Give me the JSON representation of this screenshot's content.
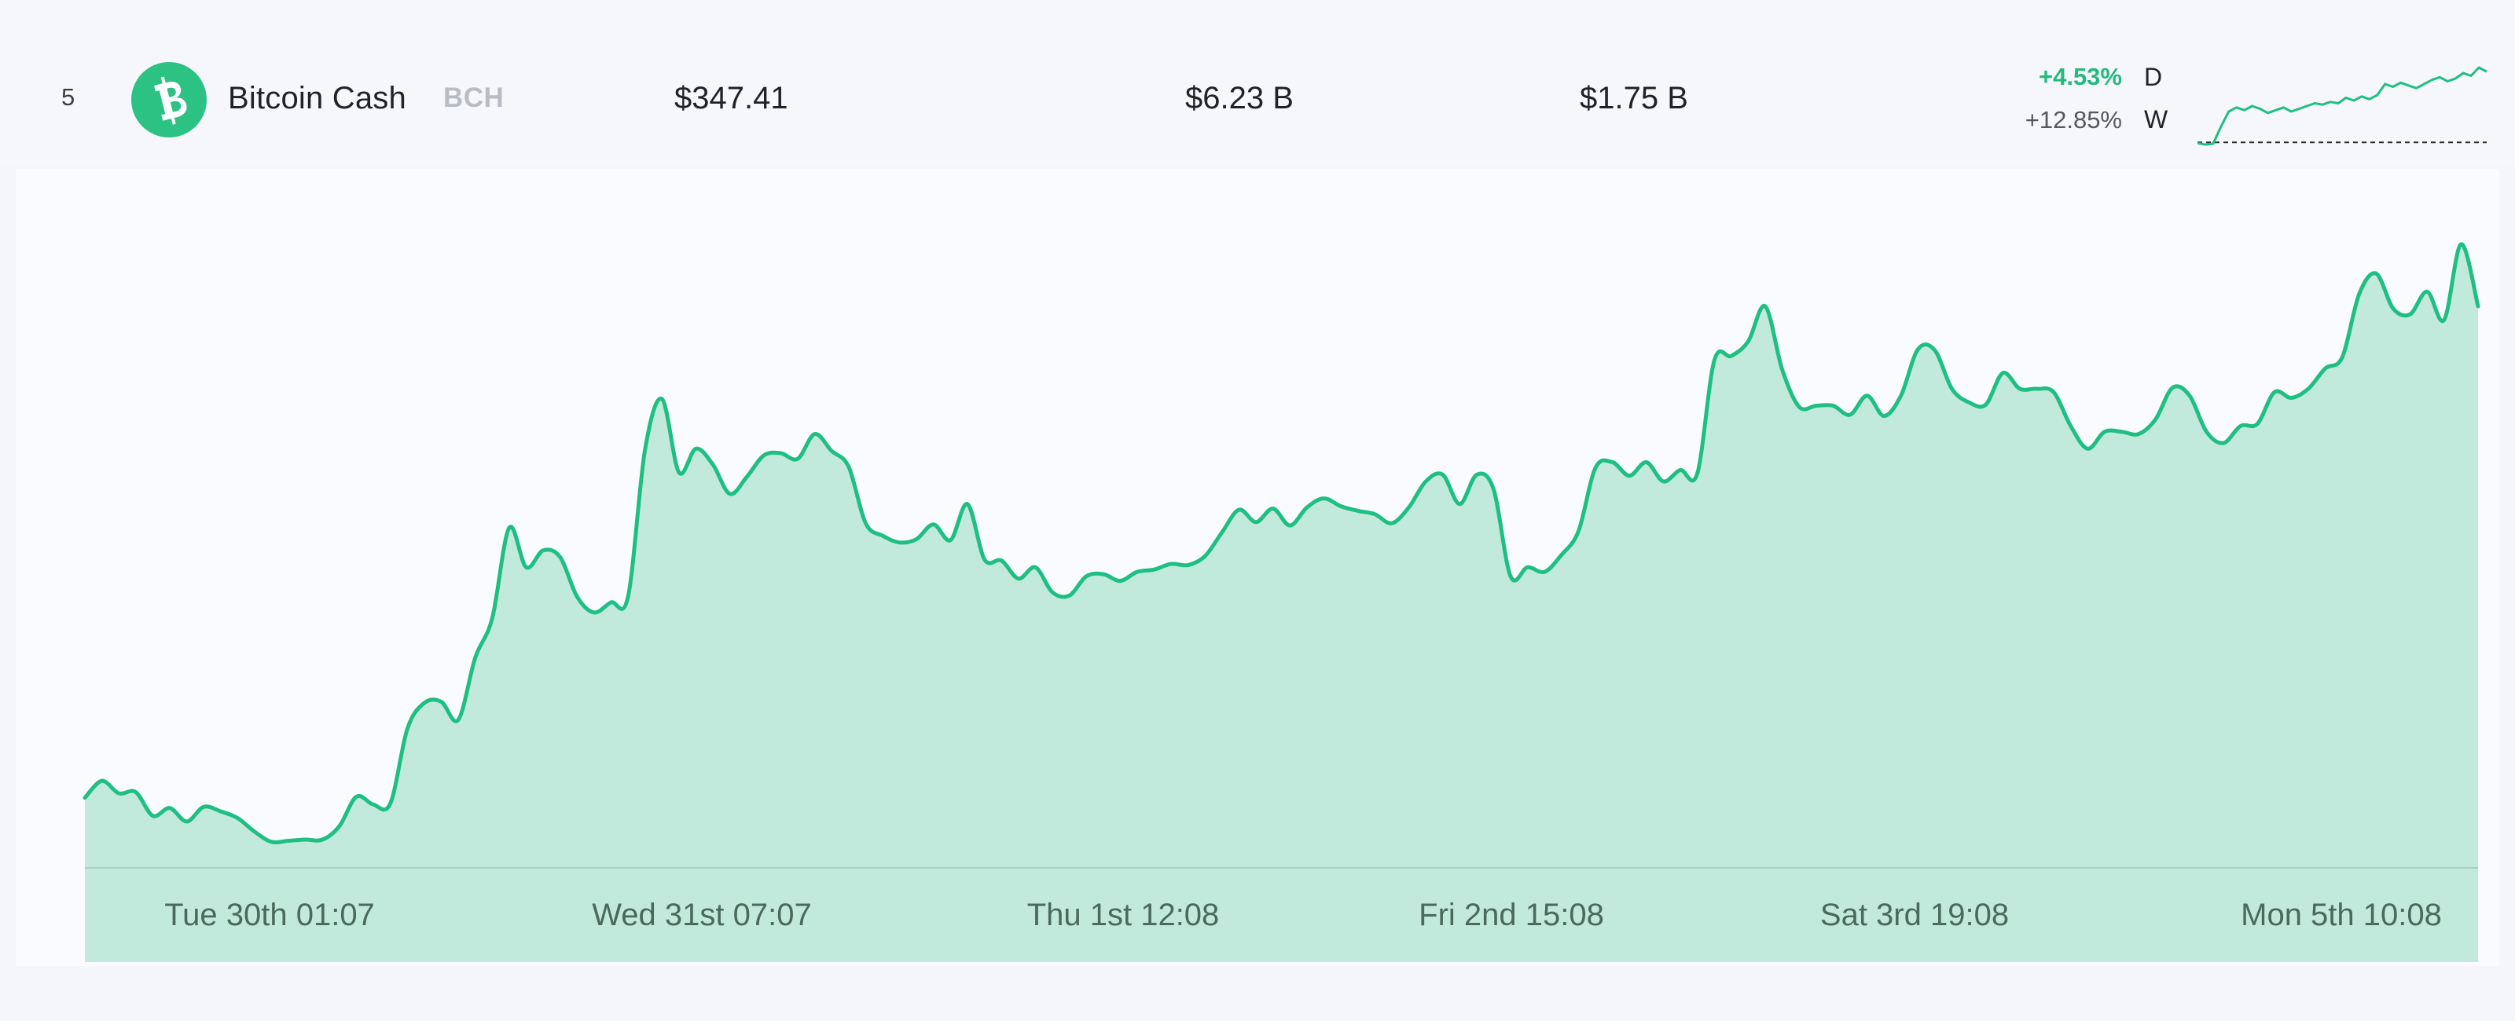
{
  "row": {
    "rank": "5",
    "coin_name": "Bitcoin Cash",
    "coin_symbol": "BCH",
    "logo_icon": "bitcoin-cash-icon",
    "price": "$347.41",
    "market_cap": "$6.23 B",
    "volume": "$1.75 B",
    "change_day": "+4.53%",
    "change_day_label": "D",
    "change_week": "+12.85%",
    "change_week_label": "W"
  },
  "colors": {
    "accent_green": "#1fbf84",
    "fill_green": "#c2eadc",
    "logo_green": "#2cc283",
    "muted_text": "#b9bcc4"
  },
  "sparkline": {
    "type": "line",
    "values": [
      0.3,
      0.2,
      0.25,
      1.5,
      2.6,
      2.9,
      2.7,
      3.0,
      2.8,
      2.5,
      2.7,
      2.9,
      2.6,
      2.8,
      3.0,
      3.2,
      3.1,
      3.3,
      3.2,
      3.6,
      3.4,
      3.7,
      3.5,
      3.8,
      4.6,
      4.4,
      4.7,
      4.5,
      4.3,
      4.6,
      4.9,
      5.1,
      4.8,
      5.0,
      5.4,
      5.2,
      5.8,
      5.5
    ],
    "baseline": 0.3
  },
  "chart_data": {
    "type": "area",
    "x_tick_labels": [
      "Tue 30th 01:07",
      "Wed 31st 07:07",
      "Thu 1st 12:08",
      "Fri 2nd 15:08",
      "Sat 3rd 19:08",
      "Mon 5th 10:08"
    ],
    "y": [
      314.2,
      315.7,
      314.6,
      314.7,
      312.6,
      313.3,
      312.1,
      313.4,
      313.0,
      312.4,
      311.2,
      310.3,
      310.4,
      310.5,
      310.5,
      311.7,
      314.3,
      313.6,
      313.7,
      320.3,
      322.6,
      322.7,
      321.1,
      326.6,
      330.1,
      338.1,
      334.6,
      336.1,
      335.5,
      332.0,
      330.6,
      331.5,
      332.0,
      345.0,
      349.5,
      343.0,
      345.1,
      343.7,
      341.1,
      342.6,
      344.5,
      344.7,
      344.2,
      346.4,
      344.9,
      343.5,
      338.5,
      337.4,
      336.8,
      337.1,
      338.4,
      337.0,
      340.2,
      335.3,
      335.2,
      333.6,
      334.6,
      332.4,
      332.1,
      333.8,
      334.0,
      333.4,
      334.2,
      334.4,
      334.9,
      334.8,
      335.6,
      337.7,
      339.7,
      338.6,
      339.8,
      338.3,
      339.9,
      340.7,
      340.0,
      339.6,
      339.3,
      338.5,
      339.9,
      342.2,
      342.8,
      340.2,
      342.8,
      341.5,
      333.8,
      334.6,
      334.2,
      335.7,
      337.8,
      343.4,
      343.9,
      342.7,
      343.9,
      342.2,
      343.2,
      342.9,
      352.9,
      353.3,
      354.6,
      357.7,
      352.1,
      348.8,
      348.9,
      348.9,
      348.1,
      349.8,
      348.0,
      349.8,
      353.9,
      353.8,
      350.4,
      349.2,
      349.0,
      351.8,
      350.4,
      350.4,
      350.1,
      347.1,
      345.1,
      346.6,
      346.6,
      346.4,
      347.7,
      350.5,
      349.8,
      346.6,
      345.6,
      347.1,
      347.3,
      350.1,
      349.6,
      350.4,
      352.2,
      353.2,
      358.8,
      360.6,
      357.5,
      357.0,
      359.0,
      356.5,
      363.2,
      357.7
    ],
    "y_range": [
      308,
      365
    ],
    "grid": false,
    "legend": "none"
  }
}
